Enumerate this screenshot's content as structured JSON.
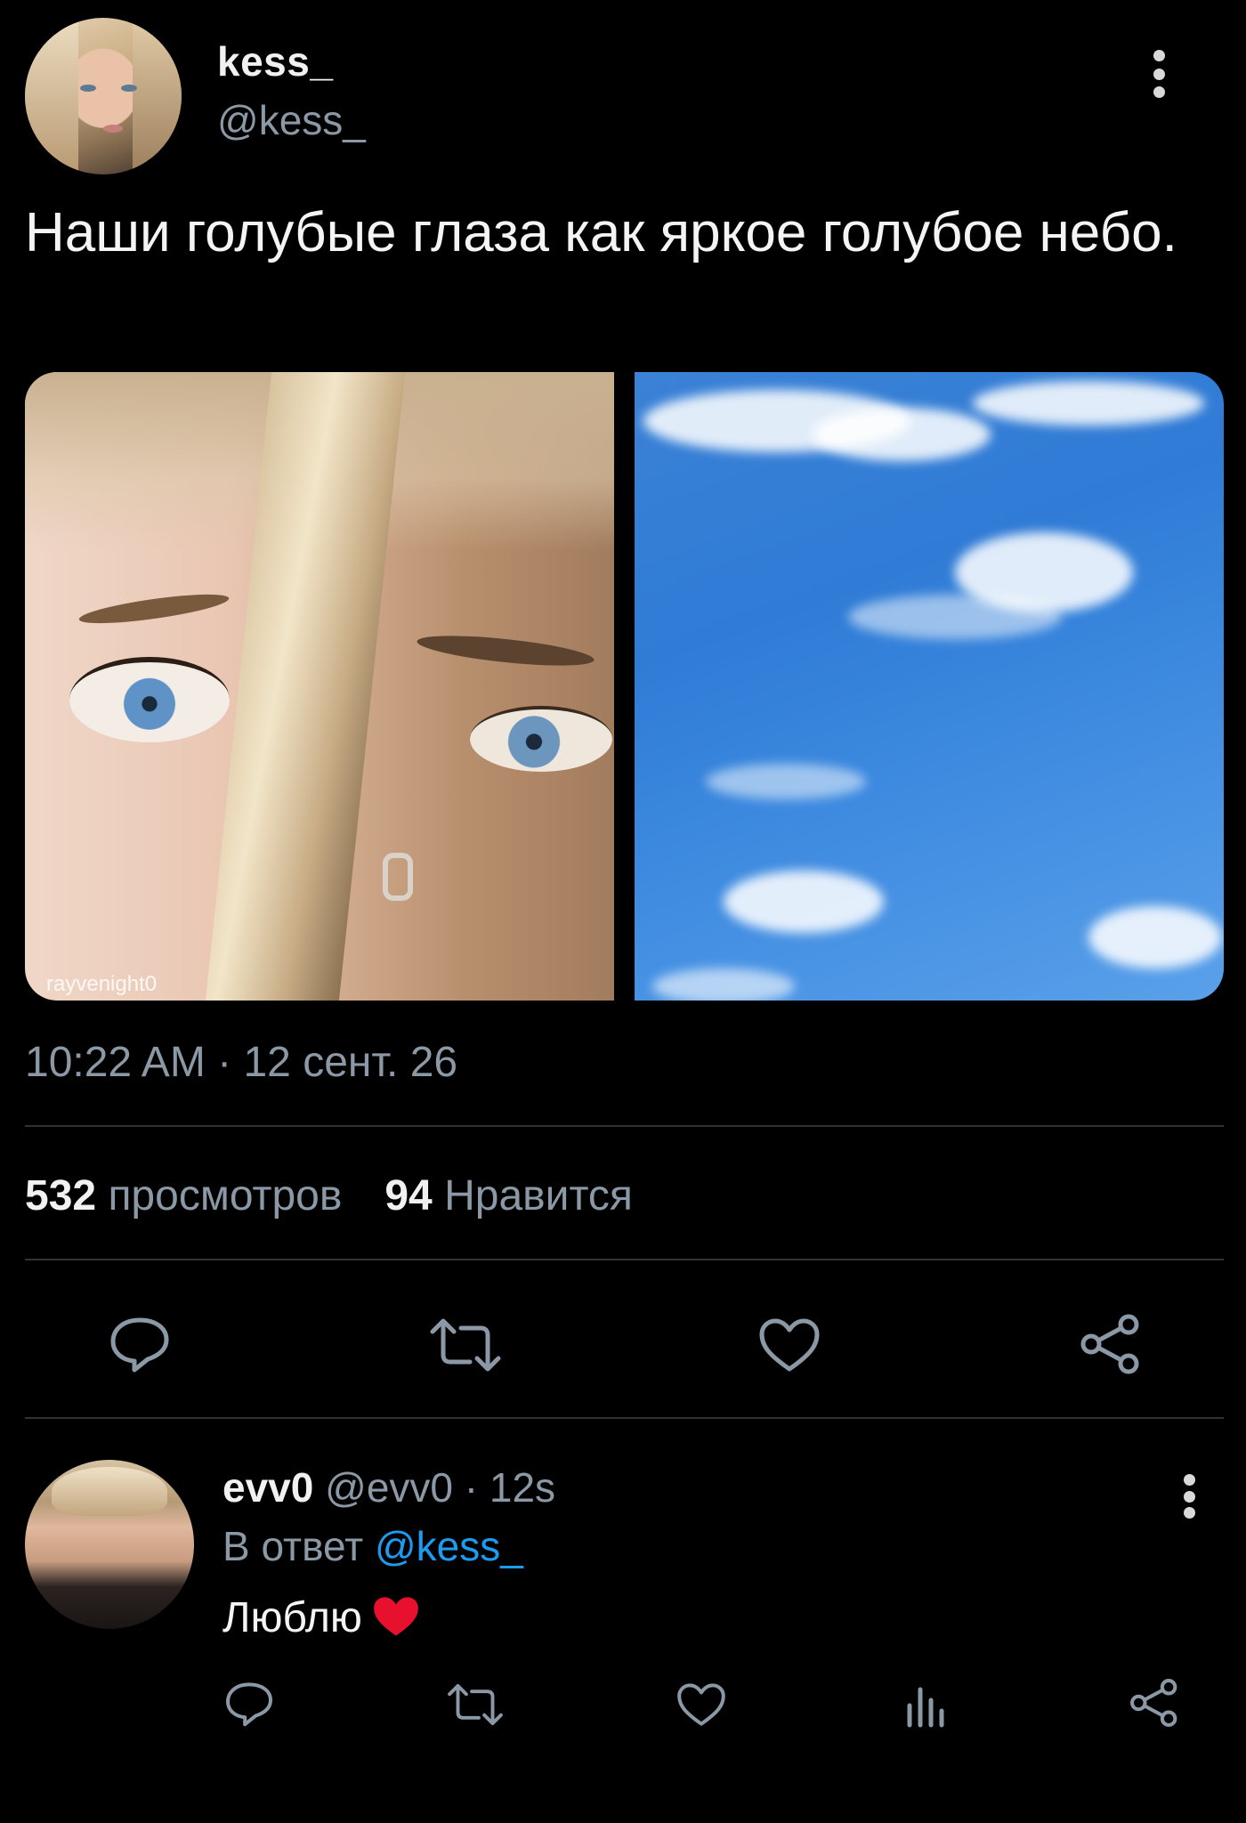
{
  "post": {
    "author_name": "kess_",
    "author_handle": "@kess_",
    "text": "Наши голубые глаза как яркое голубое небо.",
    "media_watermark": "rayvenight0",
    "timestamp": "10:22 AM · 12 сент. 26",
    "views_count": "532",
    "views_label": "просмотров",
    "likes_count": "94",
    "likes_label": "Нравится"
  },
  "reply": {
    "author_name": "evv0",
    "author_handle_time": "@evv0 · 12s",
    "reply_prefix": "В ответ",
    "reply_mention": "@kess_",
    "text": "Люблю"
  },
  "icons": {
    "post_actions": [
      "reply-icon",
      "retweet-icon",
      "like-icon",
      "share-icon"
    ],
    "reply_actions": [
      "reply-icon",
      "retweet-icon",
      "like-icon",
      "views-icon",
      "share-icon"
    ],
    "heart_emoji": "red-heart-icon"
  },
  "colors": {
    "background": "#000000",
    "muted_text": "#8b98a5",
    "link": "#1d9bf0",
    "heart": "#e8112d"
  }
}
